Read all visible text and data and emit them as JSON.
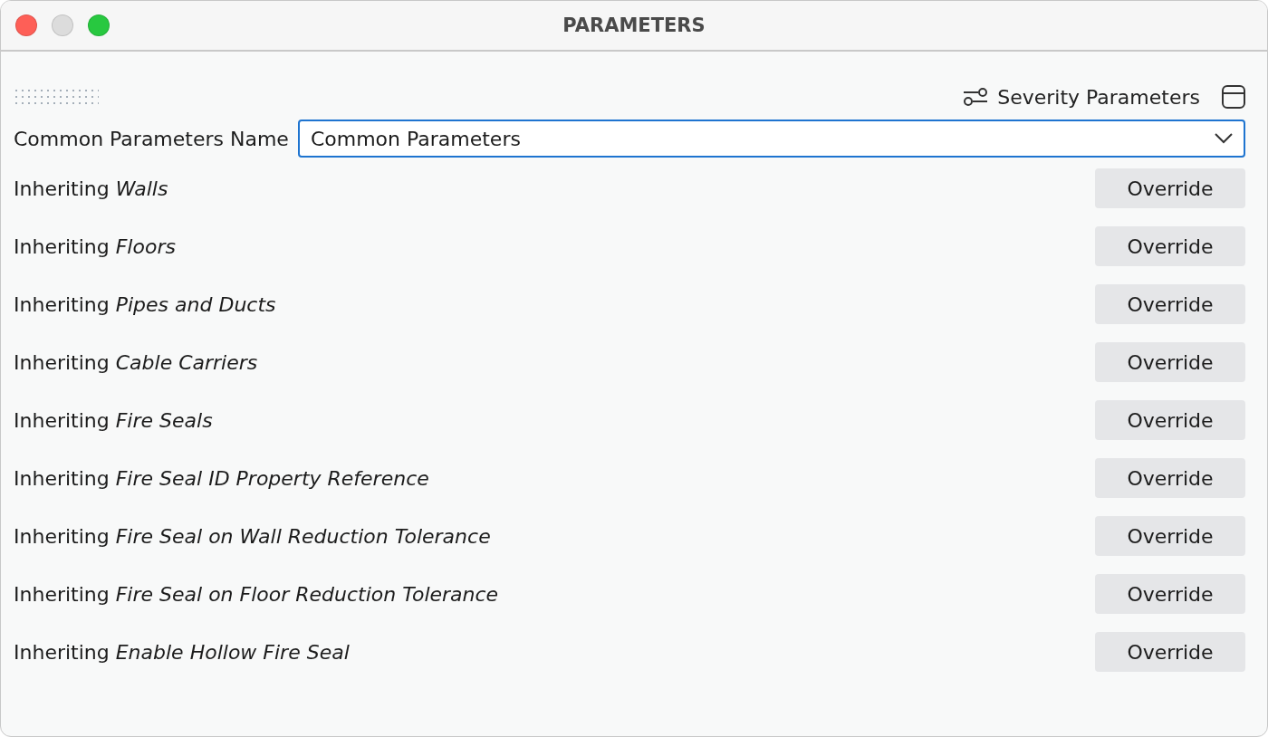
{
  "window": {
    "title": "PARAMETERS"
  },
  "toolbar": {
    "severity_button": "Severity Parameters"
  },
  "common_parameters": {
    "label": "Common Parameters Name",
    "value": "Common Parameters"
  },
  "rows": [
    {
      "label": "Inheriting *Walls*",
      "button": "Override"
    },
    {
      "label": "Inheriting *Floors*",
      "button": "Override"
    },
    {
      "label": "Inheriting *Pipes and Ducts*",
      "button": "Override"
    },
    {
      "label": "Inheriting *Cable Carriers*",
      "button": "Override"
    },
    {
      "label": "Inheriting *Fire Seals*",
      "button": "Override"
    },
    {
      "label": "Inheriting *Fire Seal ID Property Reference*",
      "button": "Override"
    },
    {
      "label": "Inheriting *Fire Seal on Wall Reduction Tolerance*",
      "button": "Override"
    },
    {
      "label": "Inheriting *Fire Seal on Floor Reduction Tolerance*",
      "button": "Override"
    },
    {
      "label": "Inheriting *Enable Hollow Fire Seal*",
      "button": "Override"
    }
  ]
}
